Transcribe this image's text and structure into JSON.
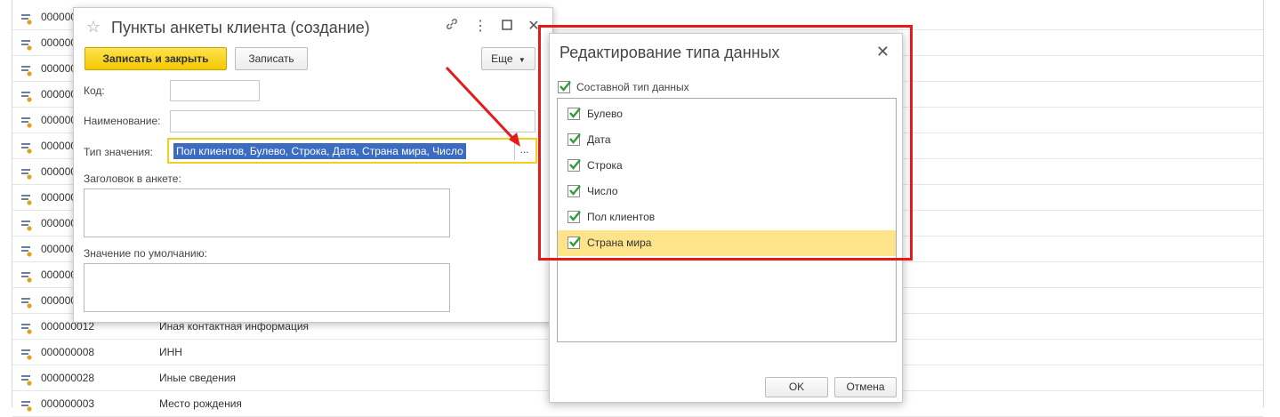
{
  "background_list": {
    "rows": [
      {
        "code": "000000",
        "name": ""
      },
      {
        "code": "000000",
        "name": ""
      },
      {
        "code": "000000",
        "name": ""
      },
      {
        "code": "000000",
        "name": ""
      },
      {
        "code": "000000",
        "name": ""
      },
      {
        "code": "000000",
        "name": ""
      },
      {
        "code": "000000",
        "name": ""
      },
      {
        "code": "000000",
        "name": ""
      },
      {
        "code": "000000",
        "name": ""
      },
      {
        "code": "000000",
        "name": ""
      },
      {
        "code": "000000",
        "name": ""
      },
      {
        "code": "000000",
        "name": ""
      },
      {
        "code": "000000012",
        "name": "Иная контактная информация"
      },
      {
        "code": "000000008",
        "name": "ИНН"
      },
      {
        "code": "000000028",
        "name": "Иные сведения"
      },
      {
        "code": "000000003",
        "name": "Место рождения"
      }
    ]
  },
  "form": {
    "title": "Пункты анкеты клиента (создание)",
    "save_close_label": "Записать и закрыть",
    "save_label": "Записать",
    "more_label": "Еще",
    "code_label": "Код:",
    "code_value": "",
    "name_label": "Наименование:",
    "name_value": "",
    "type_label": "Тип значения:",
    "type_value": "Пол клиентов, Булево, Строка, Дата, Страна мира, Число",
    "type_pick": "...",
    "header_label": "Заголовок в анкете:",
    "header_value": "",
    "default_label": "Значение по умолчанию:",
    "default_value": ""
  },
  "dialog": {
    "title": "Редактирование типа данных",
    "composite_label": "Составной тип данных",
    "composite_checked": true,
    "types": [
      {
        "label": "Булево",
        "checked": true
      },
      {
        "label": "Дата",
        "checked": true
      },
      {
        "label": "Строка",
        "checked": true
      },
      {
        "label": "Число",
        "checked": true
      },
      {
        "label": "Пол клиентов",
        "checked": true
      },
      {
        "label": "Страна мира",
        "checked": true
      }
    ],
    "active_index": 5,
    "ok_label": "OK",
    "cancel_label": "Отмена"
  },
  "colors": {
    "accent_yellow": "#f4c800",
    "selection_blue": "#3c6bc2",
    "highlight_red": "#e31b1b",
    "active_row": "#fde38a",
    "check_green": "#2e9e3a"
  }
}
